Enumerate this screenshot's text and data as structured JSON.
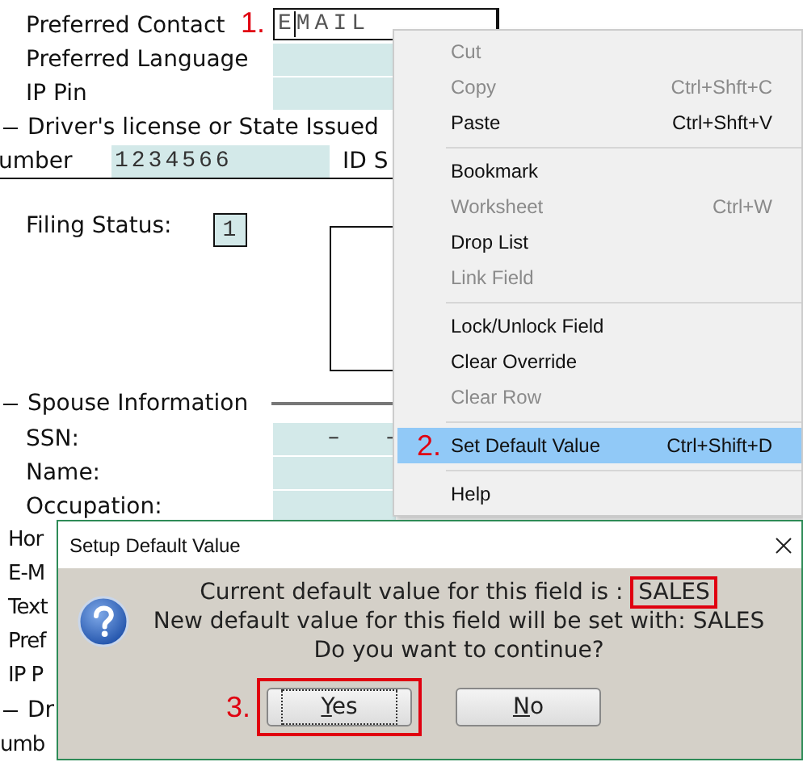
{
  "form": {
    "rows": [
      {
        "kind": "field",
        "label": "Preferred Contact",
        "value": "EMAIL",
        "focused": true,
        "annotation": "1."
      },
      {
        "kind": "field",
        "label": "Preferred Language",
        "focused": false
      },
      {
        "kind": "field",
        "label": "IP Pin",
        "focused": false
      },
      {
        "kind": "section",
        "label": "Driver's license or State Issued"
      },
      {
        "kind": "id",
        "label": "umber",
        "value": "1234566",
        "label_2": "ID S"
      },
      {
        "kind": "filing",
        "label": "Filing Status:",
        "value": "1"
      },
      {
        "kind": "section",
        "label": "Spouse Information"
      },
      {
        "kind": "field",
        "label": "SSN:",
        "focused": false,
        "value_parts": [
          "–",
          "–"
        ]
      },
      {
        "kind": "field",
        "label": "Name:",
        "focused": false
      },
      {
        "kind": "field",
        "label": "Occupation:",
        "focused": false
      },
      {
        "kind": "label",
        "label": "Hor"
      },
      {
        "kind": "label",
        "label": "E-M"
      },
      {
        "kind": "label",
        "label": "Text"
      },
      {
        "kind": "label",
        "label": "Pref"
      },
      {
        "kind": "label",
        "label": "IP P"
      },
      {
        "kind": "section",
        "label": "Dr"
      },
      {
        "kind": "cut_label",
        "label": "umb"
      }
    ]
  },
  "context_menu": {
    "items": [
      {
        "kind": "item",
        "label": "Cut",
        "disabled": true,
        "selected": false
      },
      {
        "kind": "item",
        "label": "Copy",
        "shortcut": "Ctrl+Shft+C",
        "disabled": true,
        "selected": false
      },
      {
        "kind": "item",
        "label": "Paste",
        "shortcut": "Ctrl+Shft+V",
        "disabled": false,
        "selected": false
      },
      {
        "kind": "separator"
      },
      {
        "kind": "item",
        "label": "Bookmark",
        "disabled": false,
        "selected": false
      },
      {
        "kind": "item",
        "label": "Worksheet",
        "shortcut": "Ctrl+W",
        "disabled": true,
        "selected": false
      },
      {
        "kind": "item",
        "label": "Drop List",
        "disabled": false,
        "selected": false
      },
      {
        "kind": "item",
        "label": "Link Field",
        "disabled": true,
        "selected": false
      },
      {
        "kind": "separator"
      },
      {
        "kind": "item",
        "label": "Lock/Unlock Field",
        "disabled": false,
        "selected": false
      },
      {
        "kind": "item",
        "label": "Clear Override",
        "disabled": false,
        "selected": false
      },
      {
        "kind": "item",
        "label": "Clear Row",
        "disabled": true,
        "selected": false
      },
      {
        "kind": "separator"
      },
      {
        "kind": "item",
        "label": "Set Default Value",
        "shortcut": "Ctrl+Shift+D",
        "disabled": false,
        "selected": true,
        "annotation": "2."
      },
      {
        "kind": "separator"
      },
      {
        "kind": "item",
        "label": "Help",
        "disabled": false,
        "selected": false
      }
    ]
  },
  "dialog": {
    "title": "Setup Default Value",
    "message": [
      {
        "text": "Current default value for this field is :",
        "value": "SALES",
        "marked": true
      },
      {
        "text": "New default value for this field will be set with: SALES"
      },
      {
        "text": "Do you want to continue?"
      }
    ],
    "buttons": [
      {
        "label": "Yes",
        "focused": true,
        "marked": true,
        "annotation": "3."
      },
      {
        "label": "No",
        "focused": false,
        "marked": false
      }
    ]
  }
}
